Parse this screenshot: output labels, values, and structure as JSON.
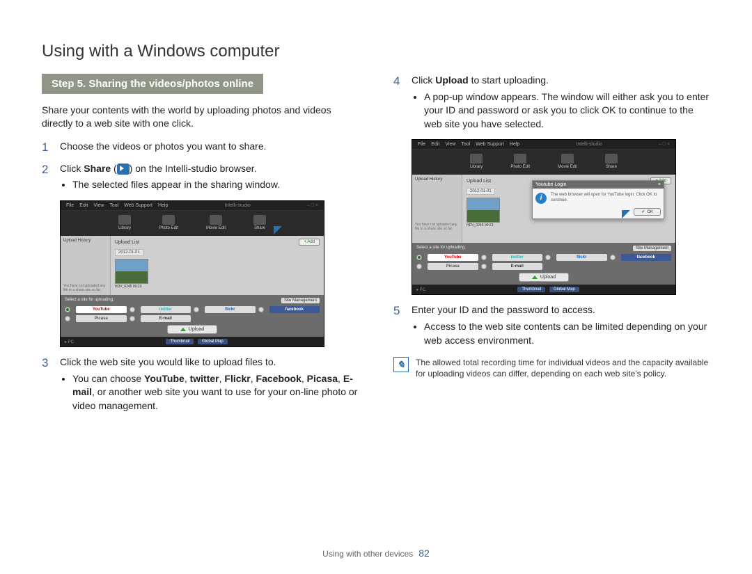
{
  "page_title": "Using with a Windows computer",
  "step_header": "Step 5. Sharing the videos/photos online",
  "intro": "Share your contents with the world by uploading photos and videos directly to a web site with one click.",
  "left_steps": {
    "s1": {
      "num": "1",
      "text": "Choose the videos or photos you want to share."
    },
    "s2": {
      "num": "2",
      "prefix": "Click ",
      "bold": "Share",
      "mid": " (",
      "suffix": ") on the Intelli-studio browser.",
      "bullet": "The selected files appear in the sharing window."
    },
    "s3": {
      "num": "3",
      "text": "Click the web site you would like to upload files to.",
      "bullet_pre": "You can choose ",
      "b1": "YouTube",
      "c1": ", ",
      "b2": "twitter",
      "c2": ", ",
      "b3": "Flickr",
      "c3": ", ",
      "b4": "Facebook",
      "c4": ", ",
      "b5": "Picasa",
      "c5": ", ",
      "b6": "E-mail",
      "bullet_post": ", or another web site you want to use for your on-line photo or video management."
    }
  },
  "right_steps": {
    "s4": {
      "num": "4",
      "prefix": "Click ",
      "bold": "Upload",
      "suffix": " to start uploading.",
      "bullet": "A pop-up window appears. The window will either ask you to enter your ID and password or ask you to click OK to continue to the web site you have selected."
    },
    "s5": {
      "num": "5",
      "text": "Enter your ID and the password to access.",
      "bullet": "Access to the web site contents can be limited depending on your web access environment."
    }
  },
  "note": "The allowed total recording time for individual videos and the capacity available for uploading videos can differ, depending on each web site's policy.",
  "footer": {
    "label": "Using with other devices",
    "page": "82"
  },
  "screenshot": {
    "menus": {
      "file": "File",
      "edit": "Edit",
      "view": "View",
      "tool": "Tool",
      "websupport": "Web Support",
      "help": "Help"
    },
    "app_title": "Intelli-studio",
    "nav": {
      "library": "Library",
      "photo_edit": "Photo Edit",
      "movie_edit": "Movie Edit",
      "share": "Share"
    },
    "upload_history": "Upload History",
    "upload_list": "Upload List",
    "add": "Add",
    "date": "2012-01-01",
    "thumb_caption": "HDV_0245  00:23",
    "side_note": "You have not uploaded any file to a share site so far.",
    "select_site": "Select a site for uploading.",
    "site_mgmt": "Site Management",
    "sites": {
      "youtube": "YouTube",
      "twitter": "twitter",
      "flickr": "flickr",
      "facebook": "facebook",
      "picasa": "Picasa",
      "email": "E-mail"
    },
    "upload_btn": "Upload",
    "footer_left": "PC",
    "footer_thumb": "Thumbnail",
    "footer_map": "Global Map",
    "dialog": {
      "title": "Youtube Login",
      "close": "×",
      "msg": "The web browser will open for YouTube login.\nClick OK to continue.",
      "ok": "OK"
    }
  }
}
